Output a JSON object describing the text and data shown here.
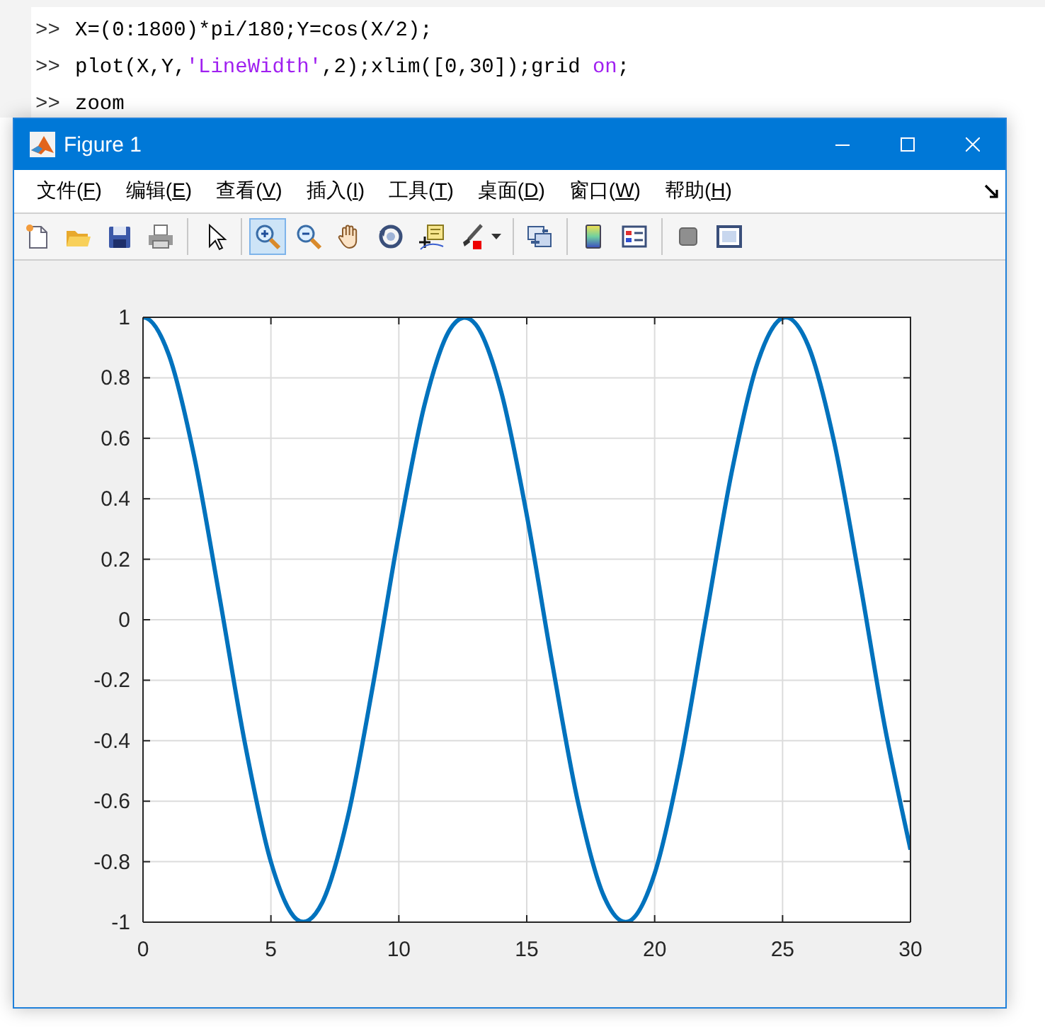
{
  "command_window": {
    "lines": [
      {
        "prompt": ">>",
        "segments": [
          {
            "kind": "code",
            "text": "X=(0:1800)*pi/180;Y=cos(X/2);"
          }
        ]
      },
      {
        "prompt": ">>",
        "segments": [
          {
            "kind": "code",
            "text": "plot(X,Y,"
          },
          {
            "kind": "string",
            "text": "'LineWidth'"
          },
          {
            "kind": "code",
            "text": ",2);xlim([0,30]);grid "
          },
          {
            "kind": "string",
            "text": "on"
          },
          {
            "kind": "code",
            "text": ";"
          }
        ]
      },
      {
        "prompt": ">>",
        "segments": [
          {
            "kind": "code",
            "text": "zoom"
          }
        ]
      }
    ]
  },
  "figure_window": {
    "title": "Figure 1",
    "menu": [
      "文件(F)",
      "编辑(E)",
      "查看(V)",
      "插入(I)",
      "工具(T)",
      "桌面(D)",
      "窗口(W)",
      "帮助(H)"
    ],
    "toolbar": [
      {
        "kind": "button",
        "selected": false
      },
      {
        "kind": "button",
        "selected": false
      },
      {
        "kind": "button",
        "selected": false
      },
      {
        "kind": "button",
        "selected": false
      },
      {
        "kind": "separator"
      },
      {
        "kind": "button",
        "selected": false
      },
      {
        "kind": "separator"
      },
      {
        "kind": "button",
        "selected": true
      },
      {
        "kind": "button",
        "selected": false
      },
      {
        "kind": "button",
        "selected": false
      },
      {
        "kind": "button",
        "selected": false
      },
      {
        "kind": "button",
        "selected": false
      },
      {
        "kind": "split-button",
        "selected": false
      },
      {
        "kind": "separator"
      },
      {
        "kind": "button",
        "selected": false
      },
      {
        "kind": "separator"
      },
      {
        "kind": "button",
        "selected": false
      },
      {
        "kind": "button",
        "selected": false
      },
      {
        "kind": "separator"
      },
      {
        "kind": "button",
        "selected": false
      },
      {
        "kind": "button",
        "selected": false
      }
    ],
    "chart_data": {
      "type": "line",
      "grid": true,
      "x": [
        0,
        1,
        2,
        3,
        4,
        5,
        6,
        7,
        8,
        9,
        10,
        11,
        12,
        13,
        14,
        15,
        16,
        17,
        18,
        19,
        20,
        21,
        22,
        23,
        24,
        25,
        26,
        27,
        28,
        29,
        30
      ],
      "series": [
        {
          "color": "#0072bd",
          "values": [
            1,
            0.878,
            0.54,
            0.071,
            -0.416,
            -0.801,
            -0.99,
            -0.936,
            -0.654,
            -0.211,
            0.284,
            0.709,
            0.96,
            0.977,
            0.754,
            0.347,
            -0.146,
            -0.602,
            -0.911,
            -0.997,
            -0.839,
            -0.476,
            0.004,
            0.483,
            0.844,
            0.998,
            0.907,
            0.594,
            0.137,
            -0.355,
            -0.76
          ]
        }
      ],
      "xlim": [
        0,
        30
      ],
      "ylim": [
        -1,
        1
      ],
      "xticks": [
        0,
        5,
        10,
        15,
        20,
        25,
        30
      ],
      "yticks": [
        -1,
        -0.8,
        -0.6,
        -0.4,
        -0.2,
        0,
        0.2,
        0.4,
        0.6,
        0.8,
        1
      ]
    }
  }
}
